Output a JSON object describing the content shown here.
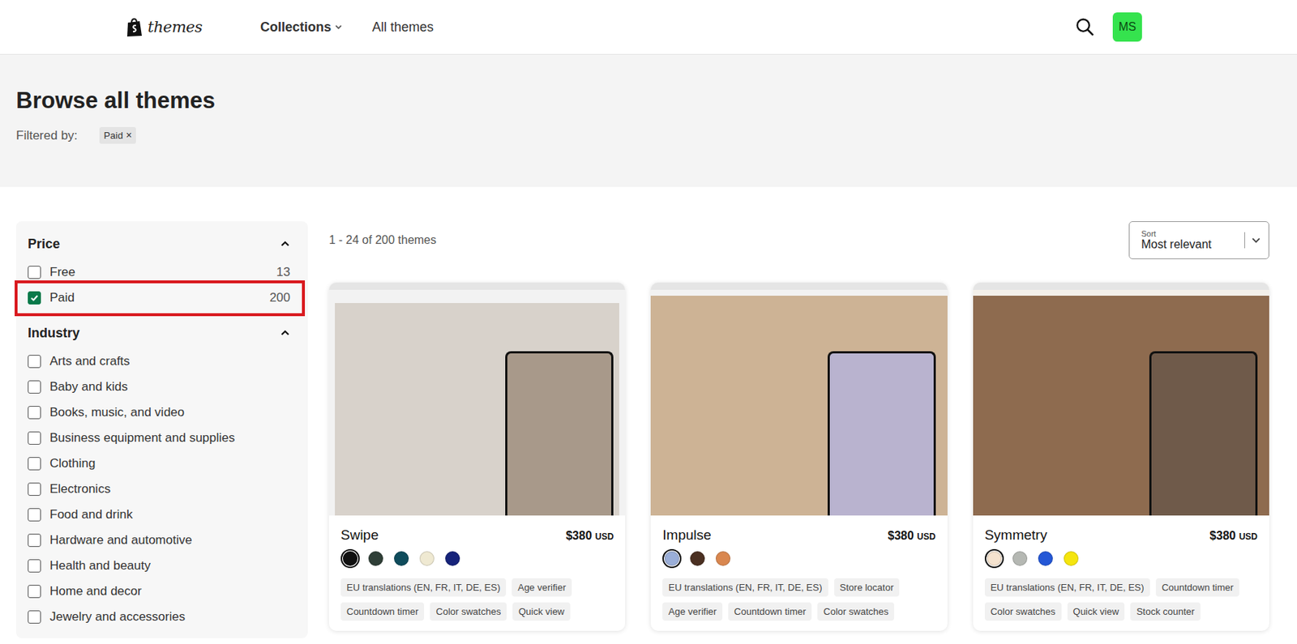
{
  "header": {
    "logo": "themes",
    "nav": [
      {
        "label": "Collections",
        "has_menu": true
      },
      {
        "label": "All themes",
        "has_menu": false
      }
    ],
    "avatar": "MS"
  },
  "hero": {
    "title": "Browse all themes",
    "filter_label": "Filtered by:",
    "filters": [
      {
        "label": "Paid",
        "remove": "×"
      }
    ]
  },
  "sidebar": {
    "groups": [
      {
        "title": "Price",
        "expanded": true,
        "options": [
          {
            "label": "Free",
            "count": "13",
            "checked": false,
            "highlighted": false
          },
          {
            "label": "Paid",
            "count": "200",
            "checked": true,
            "highlighted": true
          }
        ]
      },
      {
        "title": "Industry",
        "expanded": true,
        "options": [
          {
            "label": "Arts and crafts",
            "count": "",
            "checked": false,
            "highlighted": false
          },
          {
            "label": "Baby and kids",
            "count": "",
            "checked": false,
            "highlighted": false
          },
          {
            "label": "Books, music, and video",
            "count": "",
            "checked": false,
            "highlighted": false
          },
          {
            "label": "Business equipment and supplies",
            "count": "",
            "checked": false,
            "highlighted": false
          },
          {
            "label": "Clothing",
            "count": "",
            "checked": false,
            "highlighted": false
          },
          {
            "label": "Electronics",
            "count": "",
            "checked": false,
            "highlighted": false
          },
          {
            "label": "Food and drink",
            "count": "",
            "checked": false,
            "highlighted": false
          },
          {
            "label": "Hardware and automotive",
            "count": "",
            "checked": false,
            "highlighted": false
          },
          {
            "label": "Health and beauty",
            "count": "",
            "checked": false,
            "highlighted": false
          },
          {
            "label": "Home and decor",
            "count": "",
            "checked": false,
            "highlighted": false
          },
          {
            "label": "Jewelry and accessories",
            "count": "",
            "checked": false,
            "highlighted": false
          }
        ]
      }
    ]
  },
  "results": {
    "summary": "1 - 24 of 200 themes",
    "sort": {
      "label": "Sort",
      "value": "Most relevant"
    }
  },
  "themes": [
    {
      "name": "Swipe",
      "price": "$380",
      "currency": "USD",
      "swatches": [
        {
          "color": "#111111",
          "selected": true
        },
        {
          "color": "#2f3f37",
          "selected": false
        },
        {
          "color": "#0f4c5c",
          "selected": false
        },
        {
          "color": "#efe9d2",
          "selected": false
        },
        {
          "color": "#16237a",
          "selected": false
        }
      ],
      "tags": [
        "EU translations (EN, FR, IT, DE, ES)",
        "Age verifier",
        "Countdown timer",
        "Color swatches",
        "Quick view"
      ]
    },
    {
      "name": "Impulse",
      "price": "$380",
      "currency": "USD",
      "swatches": [
        {
          "color": "#9aaed8",
          "selected": true
        },
        {
          "color": "#4b3022",
          "selected": false
        },
        {
          "color": "#d9874f",
          "selected": false
        }
      ],
      "tags": [
        "EU translations (EN, FR, IT, DE, ES)",
        "Store locator",
        "Age verifier",
        "Countdown timer",
        "Color swatches"
      ]
    },
    {
      "name": "Symmetry",
      "price": "$380",
      "currency": "USD",
      "swatches": [
        {
          "color": "#f5e3cf",
          "selected": true
        },
        {
          "color": "#b5b8b3",
          "selected": false
        },
        {
          "color": "#2457d6",
          "selected": false
        },
        {
          "color": "#f5e50e",
          "selected": false
        }
      ],
      "tags": [
        "EU translations (EN, FR, IT, DE, ES)",
        "Countdown timer",
        "Color swatches",
        "Quick view",
        "Stock counter"
      ]
    }
  ]
}
